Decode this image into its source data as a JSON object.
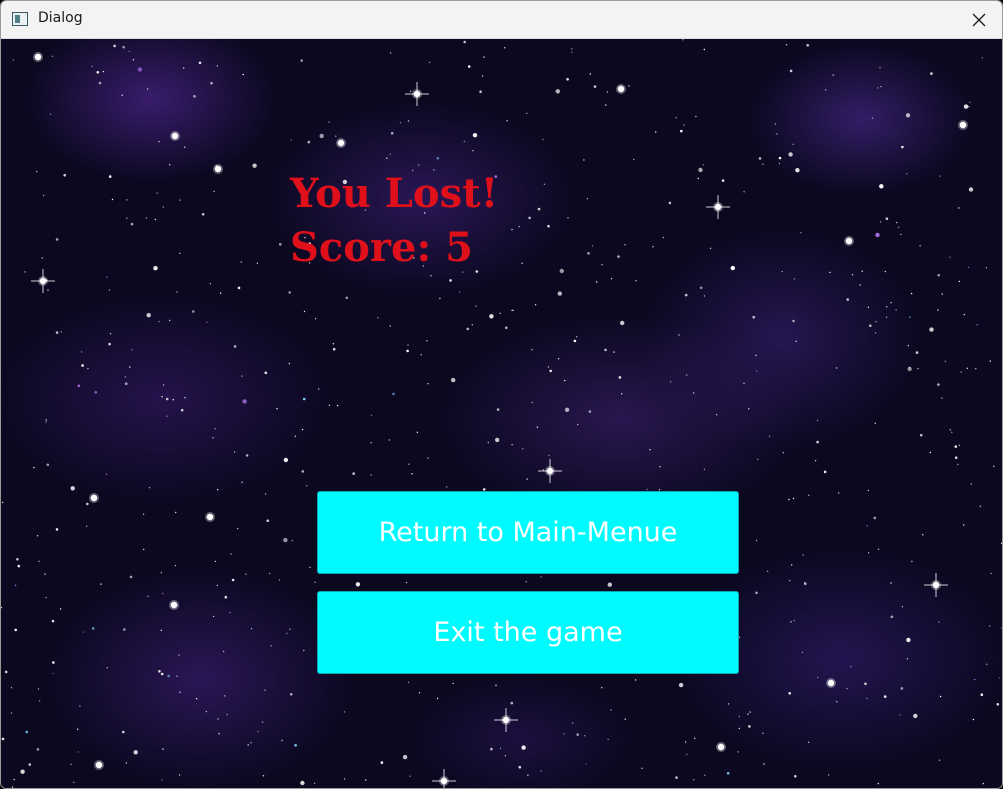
{
  "window": {
    "title": "Dialog",
    "close_icon": "close-icon",
    "app_icon": "window-app-icon"
  },
  "game_over": {
    "heading": "You Lost!",
    "score_text": "Score: 5",
    "score": 5,
    "text_color": "#e0101b"
  },
  "buttons": {
    "return_label": "Return to Main-Menue",
    "exit_label": "Exit the game",
    "background_color": "#00fbff",
    "text_color": "#ffffff"
  },
  "background": {
    "description_type": "starfield",
    "colors": [
      "#0b0820",
      "#5a2daa"
    ]
  }
}
